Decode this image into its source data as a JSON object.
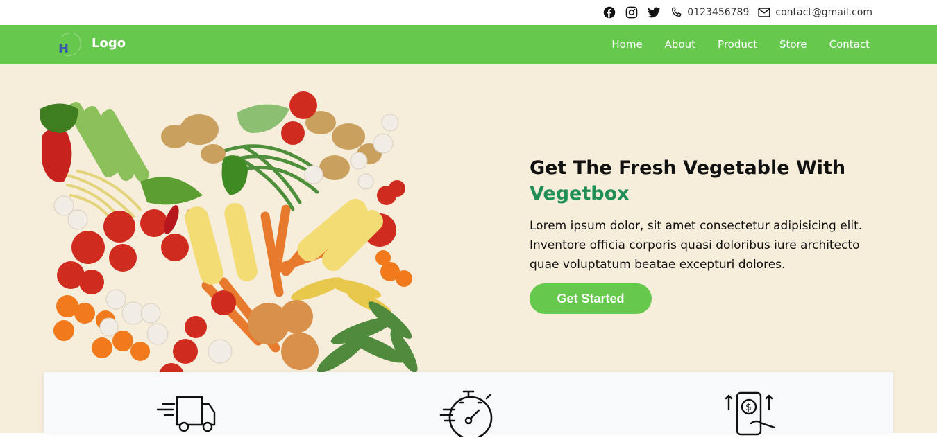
{
  "topbar": {
    "social_icons": [
      "facebook-icon",
      "instagram-icon",
      "twitter-icon"
    ],
    "phone": "0123456789",
    "email": "contact@gmail.com"
  },
  "navbar": {
    "logo_text": "Logo",
    "logo_letter": "H",
    "links": [
      "Home",
      "About",
      "Product",
      "Store",
      "Contact"
    ]
  },
  "hero": {
    "title_part1": "Get The Fresh Vegetable ",
    "title_bold": "With",
    "title_brand": "Vegetbox",
    "description": "Lorem ipsum dolor, sit amet consectetur adipisicing elit. Inventore officia corporis quasi doloribus iure architecto quae voluptatum beatae excepturi dolores.",
    "cta_label": "Get Started"
  },
  "features": {
    "icons": [
      "delivery-truck-icon",
      "stopwatch-icon",
      "mobile-payment-icon"
    ]
  },
  "colors": {
    "brand_green": "#66c84d",
    "hero_bg": "#f6eddb",
    "brand_text": "#1f8f57"
  }
}
